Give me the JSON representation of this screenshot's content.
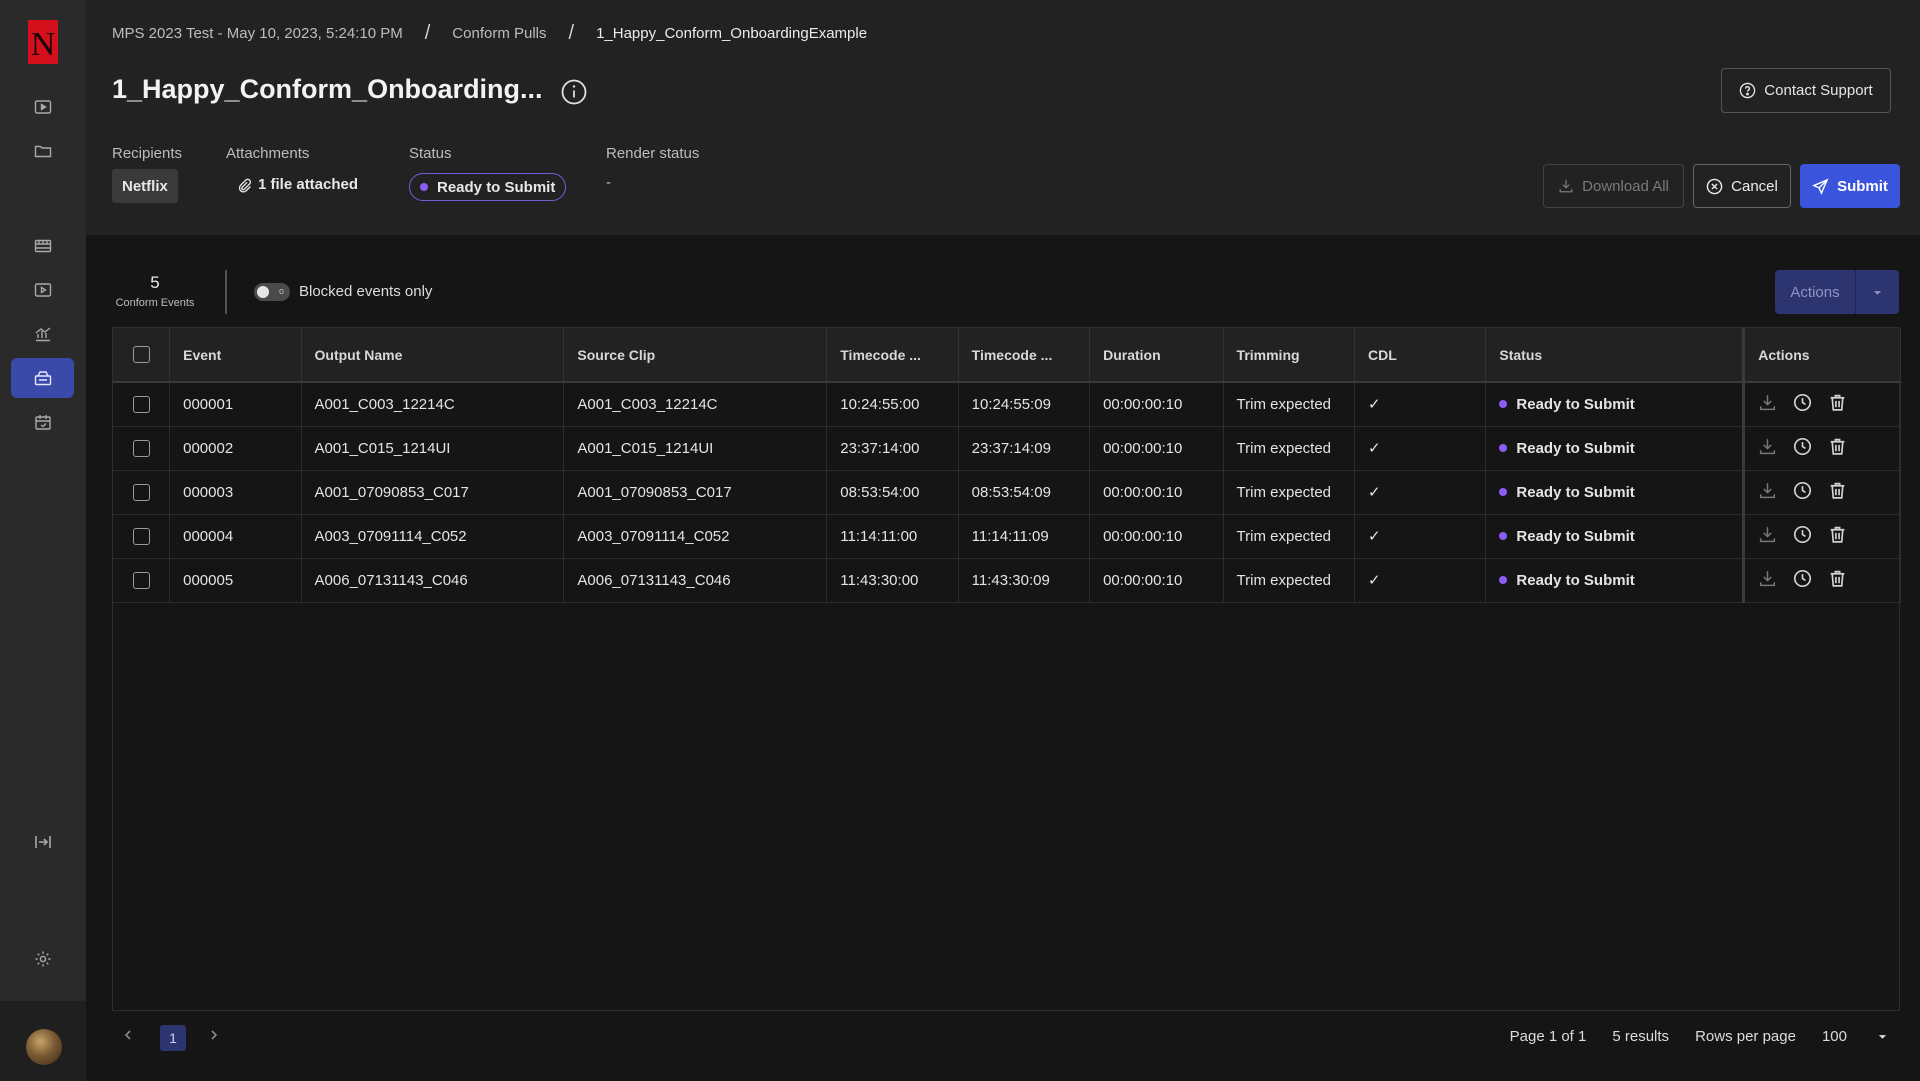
{
  "app": {
    "logo_letter": "N"
  },
  "sidebar": {
    "items": [
      {
        "name": "play-icon"
      },
      {
        "name": "folder-icon"
      },
      {
        "name": "film-icon"
      },
      {
        "name": "media-icon"
      },
      {
        "name": "chart-icon"
      },
      {
        "name": "conform-icon",
        "active": true
      },
      {
        "name": "calendar-icon"
      },
      {
        "name": "collapse-icon"
      },
      {
        "name": "gear-icon"
      }
    ]
  },
  "breadcrumb": {
    "items": [
      "MPS 2023 Test - May 10, 2023, 5:24:10 PM",
      "Conform Pulls",
      "1_Happy_Conform_OnboardingExample"
    ],
    "separator": "/"
  },
  "header": {
    "title": "1_Happy_Conform_Onboarding...",
    "contact_support": "Contact Support",
    "recipients_label": "Recipients",
    "recipients_value": "Netflix",
    "attachments_label": "Attachments",
    "attachments_value": "1 file attached",
    "status_label": "Status",
    "status_value": "Ready to Submit",
    "render_status_label": "Render status",
    "render_status_value": "-",
    "download_all": "Download All",
    "cancel": "Cancel",
    "submit": "Submit"
  },
  "toolbar": {
    "events_count": "5",
    "events_label": "Conform Events",
    "blocked_toggle_label": "Blocked events only",
    "toggle_state": "o",
    "actions_label": "Actions"
  },
  "table": {
    "columns": [
      "Event",
      "Output Name",
      "Source Clip",
      "Timecode ...",
      "Timecode ...",
      "Duration",
      "Trimming",
      "CDL",
      "Status",
      "Actions"
    ],
    "rows": [
      {
        "event": "000001",
        "output": "A001_C003_12214C",
        "source": "A001_C003_12214C",
        "tc_in": "10:24:55:00",
        "tc_out": "10:24:55:09",
        "duration": "00:00:00:10",
        "trimming": "Trim expected",
        "cdl": "✓",
        "status": "Ready to Submit"
      },
      {
        "event": "000002",
        "output": "A001_C015_1214UI",
        "source": "A001_C015_1214UI",
        "tc_in": "23:37:14:00",
        "tc_out": "23:37:14:09",
        "duration": "00:00:00:10",
        "trimming": "Trim expected",
        "cdl": "✓",
        "status": "Ready to Submit"
      },
      {
        "event": "000003",
        "output": "A001_07090853_C017",
        "source": "A001_07090853_C017",
        "tc_in": "08:53:54:00",
        "tc_out": "08:53:54:09",
        "duration": "00:00:00:10",
        "trimming": "Trim expected",
        "cdl": "✓",
        "status": "Ready to Submit"
      },
      {
        "event": "000004",
        "output": "A003_07091114_C052",
        "source": "A003_07091114_C052",
        "tc_in": "11:14:11:00",
        "tc_out": "11:14:11:09",
        "duration": "00:00:00:10",
        "trimming": "Trim expected",
        "cdl": "✓",
        "status": "Ready to Submit"
      },
      {
        "event": "000005",
        "output": "A006_07131143_C046",
        "source": "A006_07131143_C046",
        "tc_in": "11:43:30:00",
        "tc_out": "11:43:30:09",
        "duration": "00:00:00:10",
        "trimming": "Trim expected",
        "cdl": "✓",
        "status": "Ready to Submit"
      }
    ]
  },
  "pagination": {
    "current_page": "1",
    "page_info": "Page 1 of 1",
    "results": "5 results",
    "rows_per_page_label": "Rows per page",
    "rows_per_page_value": "100"
  },
  "colors": {
    "accent": "#3b54dc",
    "status_dot": "#8b5cf6",
    "brand": "#e50914"
  }
}
